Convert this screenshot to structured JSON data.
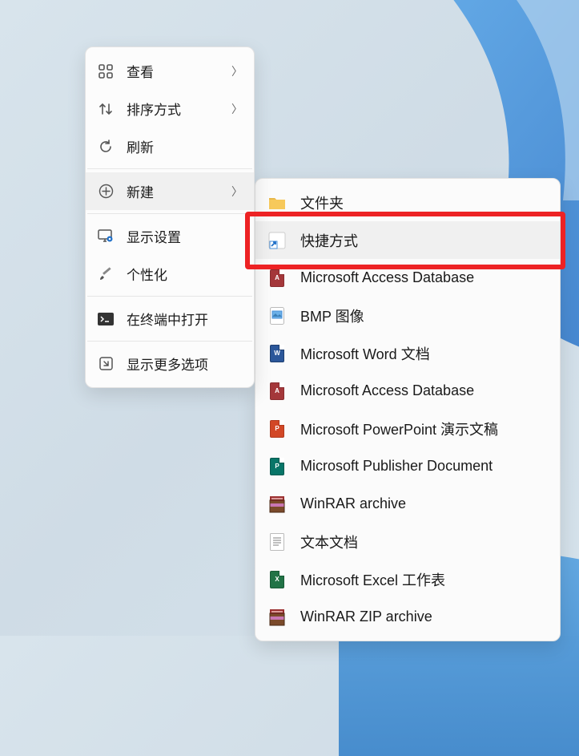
{
  "context_menu": {
    "items": [
      {
        "label": "查看",
        "has_submenu": true
      },
      {
        "label": "排序方式",
        "has_submenu": true
      },
      {
        "label": "刷新",
        "has_submenu": false
      },
      {
        "label": "新建",
        "has_submenu": true,
        "selected": true
      },
      {
        "label": "显示设置",
        "has_submenu": false
      },
      {
        "label": "个性化",
        "has_submenu": false
      },
      {
        "label": "在终端中打开",
        "has_submenu": false
      },
      {
        "label": "显示更多选项",
        "has_submenu": false
      }
    ]
  },
  "submenu": {
    "items": [
      {
        "label": "文件夹"
      },
      {
        "label": "快捷方式",
        "highlighted": true
      },
      {
        "label": "Microsoft Access Database"
      },
      {
        "label": "BMP 图像"
      },
      {
        "label": "Microsoft Word 文档"
      },
      {
        "label": "Microsoft Access Database"
      },
      {
        "label": "Microsoft PowerPoint 演示文稿"
      },
      {
        "label": "Microsoft Publisher Document"
      },
      {
        "label": "WinRAR archive"
      },
      {
        "label": "文本文档"
      },
      {
        "label": "Microsoft Excel 工作表"
      },
      {
        "label": "WinRAR ZIP archive"
      }
    ]
  }
}
